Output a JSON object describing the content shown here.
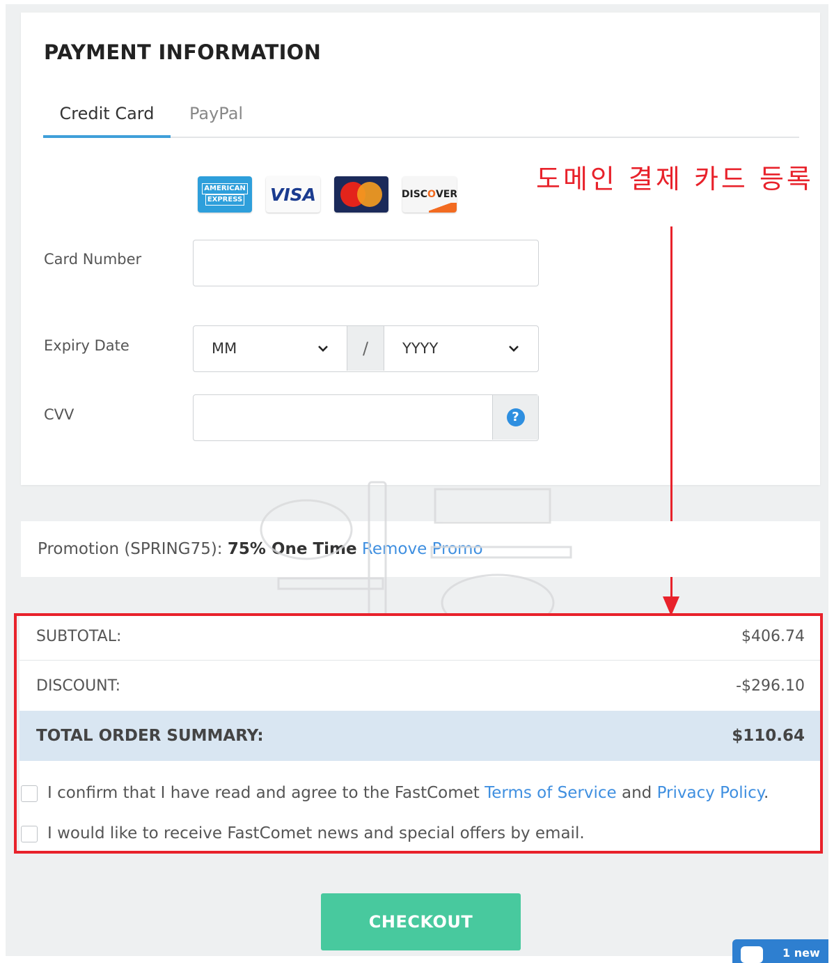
{
  "payment": {
    "title": "PAYMENT INFORMATION",
    "tabs": [
      {
        "label": "Credit Card",
        "active": true
      },
      {
        "label": "PayPal",
        "active": false
      }
    ],
    "card_brands": [
      {
        "name": "american-express",
        "label_line1": "AMERICAN",
        "label_line2": "EXPRESS"
      },
      {
        "name": "visa",
        "label": "VISA"
      },
      {
        "name": "mastercard"
      },
      {
        "name": "discover",
        "label_pre": "DISC",
        "label_o": "O",
        "label_post": "VER"
      }
    ],
    "fields": {
      "card_number_label": "Card Number",
      "card_number_value": "",
      "expiry_label": "Expiry Date",
      "month_value": "MM",
      "separator": "/",
      "year_value": "YYYY",
      "cvv_label": "CVV",
      "cvv_value": "",
      "help_glyph": "?"
    }
  },
  "annotation": {
    "text": "도메인 결제 카드 등록",
    "color": "#e8222b"
  },
  "promo": {
    "prefix": "Promotion (SPRING75):",
    "deal": "75% One Time",
    "remove_link": "Remove Promo"
  },
  "summary": {
    "subtotal_label": "SUBTOTAL:",
    "subtotal_value": "$406.74",
    "discount_label": "DISCOUNT:",
    "discount_value": "-$296.10",
    "total_label": "TOTAL ORDER SUMMARY:",
    "total_value": "$110.64"
  },
  "agreements": {
    "terms_prefix": "I confirm that I have read and agree to the FastComet",
    "terms_link": "Terms of Service",
    "terms_and": "and",
    "privacy_link": "Privacy Policy",
    "terms_suffix": ".",
    "newsletter": "I would like to receive FastComet news and special offers by email."
  },
  "checkout_label": "CHECKOUT",
  "chat_label": "1 new",
  "colors": {
    "accent": "#3f9fd9",
    "link": "#3f8fe0",
    "checkout": "#48c99e",
    "total_bg": "#d9e6f2",
    "annotation_red": "#e8222b"
  },
  "icons": [
    "question-circle-icon",
    "chevron-down-icon",
    "chat-icon",
    "arrow-down-icon"
  ]
}
